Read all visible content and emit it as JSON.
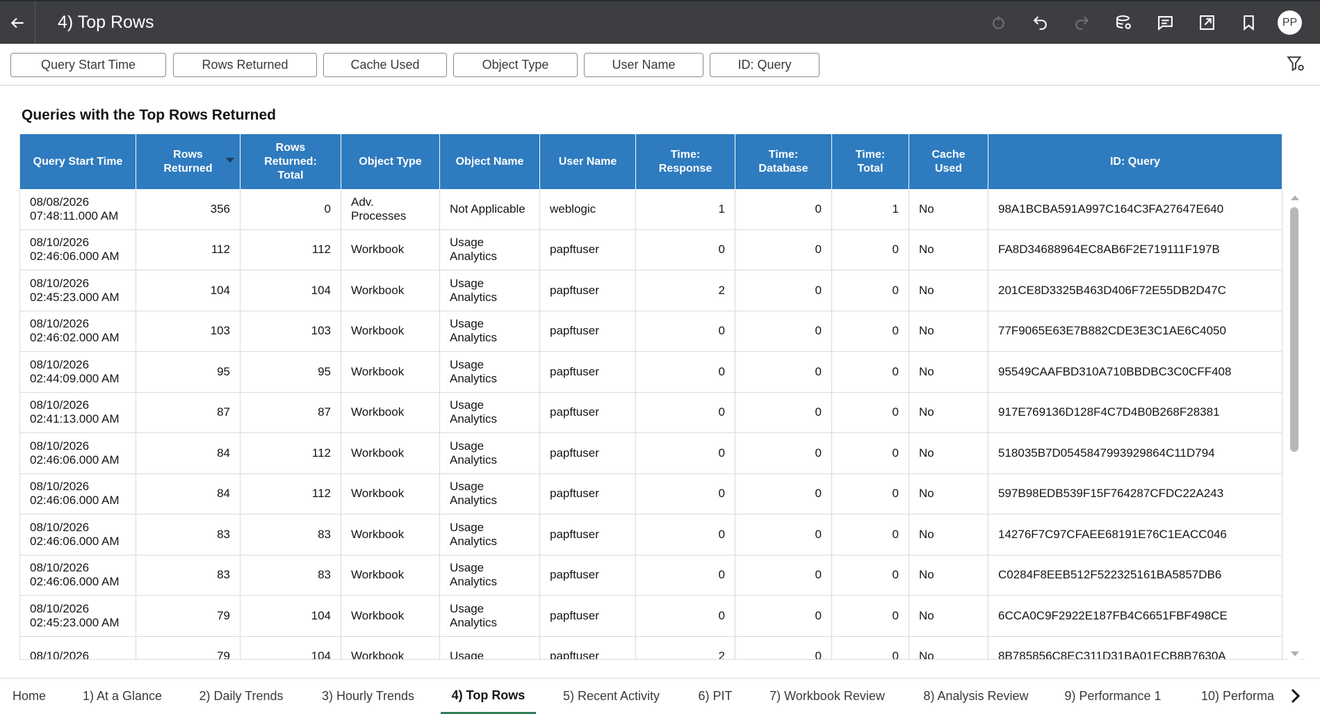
{
  "header": {
    "title": "4) Top Rows",
    "avatar_initials": "PP"
  },
  "filters": [
    {
      "label": "Query Start Time"
    },
    {
      "label": "Rows Returned"
    },
    {
      "label": "Cache Used"
    },
    {
      "label": "Object Type"
    },
    {
      "label": "User Name"
    },
    {
      "label": "ID: Query"
    }
  ],
  "viz": {
    "title": "Queries with the Top Rows Returned",
    "sorted_column": "Rows Returned",
    "sort_direction": "descending"
  },
  "table": {
    "columns": [
      "Query Start Time",
      "Rows Returned",
      "Rows Returned: Total",
      "Object Type",
      "Object Name",
      "User Name",
      "Time: Response",
      "Time: Database",
      "Time: Total",
      "Cache Used",
      "ID: Query"
    ],
    "rows": [
      [
        "08/08/2026 07:48:11.000 AM",
        "356",
        "0",
        "Adv. Processes",
        "Not Applicable",
        "weblogic",
        "1",
        "0",
        "1",
        "No",
        "98A1BCBA591A997C164C3FA27647E640"
      ],
      [
        "08/10/2026 02:46:06.000 AM",
        "112",
        "112",
        "Workbook",
        "Usage Analytics",
        "papftuser",
        "0",
        "0",
        "0",
        "No",
        "FA8D34688964EC8AB6F2E719111F197B"
      ],
      [
        "08/10/2026 02:45:23.000 AM",
        "104",
        "104",
        "Workbook",
        "Usage Analytics",
        "papftuser",
        "2",
        "0",
        "0",
        "No",
        "201CE8D3325B463D406F72E55DB2D47C"
      ],
      [
        "08/10/2026 02:46:02.000 AM",
        "103",
        "103",
        "Workbook",
        "Usage Analytics",
        "papftuser",
        "0",
        "0",
        "0",
        "No",
        "77F9065E63E7B882CDE3E3C1AE6C4050"
      ],
      [
        "08/10/2026 02:44:09.000 AM",
        "95",
        "95",
        "Workbook",
        "Usage Analytics",
        "papftuser",
        "0",
        "0",
        "0",
        "No",
        "95549CAAFBD310A710BBDBC3C0CFF408"
      ],
      [
        "08/10/2026 02:41:13.000 AM",
        "87",
        "87",
        "Workbook",
        "Usage Analytics",
        "papftuser",
        "0",
        "0",
        "0",
        "No",
        "917E769136D128F4C7D4B0B268F28381"
      ],
      [
        "08/10/2026 02:46:06.000 AM",
        "84",
        "112",
        "Workbook",
        "Usage Analytics",
        "papftuser",
        "0",
        "0",
        "0",
        "No",
        "518035B7D0545847993929864C11D794"
      ],
      [
        "08/10/2026 02:46:06.000 AM",
        "84",
        "112",
        "Workbook",
        "Usage Analytics",
        "papftuser",
        "0",
        "0",
        "0",
        "No",
        "597B98EDB539F15F764287CFDC22A243"
      ],
      [
        "08/10/2026 02:46:06.000 AM",
        "83",
        "83",
        "Workbook",
        "Usage Analytics",
        "papftuser",
        "0",
        "0",
        "0",
        "No",
        "14276F7C97CFAEE68191E76C1EACC046"
      ],
      [
        "08/10/2026 02:46:06.000 AM",
        "83",
        "83",
        "Workbook",
        "Usage Analytics",
        "papftuser",
        "0",
        "0",
        "0",
        "No",
        "C0284F8EEB512F522325161BA5857DB6"
      ],
      [
        "08/10/2026 02:45:23.000 AM",
        "79",
        "104",
        "Workbook",
        "Usage Analytics",
        "papftuser",
        "0",
        "0",
        "0",
        "No",
        "6CCA0C9F2922E187FB4C6651FBF498CE"
      ],
      [
        "08/10/2026",
        "79",
        "104",
        "Workbook",
        "Usage",
        "papftuser",
        "2",
        "0",
        "0",
        "No",
        "8B785856C8EC311D31BA01ECB8B7630A"
      ]
    ]
  },
  "tabs": [
    {
      "label": "Home"
    },
    {
      "label": "1) At a Glance"
    },
    {
      "label": "2) Daily Trends"
    },
    {
      "label": "3) Hourly Trends"
    },
    {
      "label": "4) Top Rows"
    },
    {
      "label": "5) Recent Activity"
    },
    {
      "label": "6) PIT"
    },
    {
      "label": "7) Workbook Review"
    },
    {
      "label": "8) Analysis Review"
    },
    {
      "label": "9) Performance 1"
    },
    {
      "label": "10) Performa"
    }
  ],
  "active_tab": "4) Top Rows",
  "icons": {
    "back": "arrow-left-icon",
    "tools": [
      "refresh-icon",
      "undo-icon",
      "redo-icon",
      "data-icon",
      "comment-icon",
      "export-icon",
      "bookmark-icon"
    ],
    "filter": "filter-settings-icon",
    "tab_next": "chevron-right-icon"
  },
  "colors": {
    "header_bg": "#3c3e42",
    "table_header_bg": "#2e7bbf",
    "active_tab_underline": "#2e7d55"
  }
}
